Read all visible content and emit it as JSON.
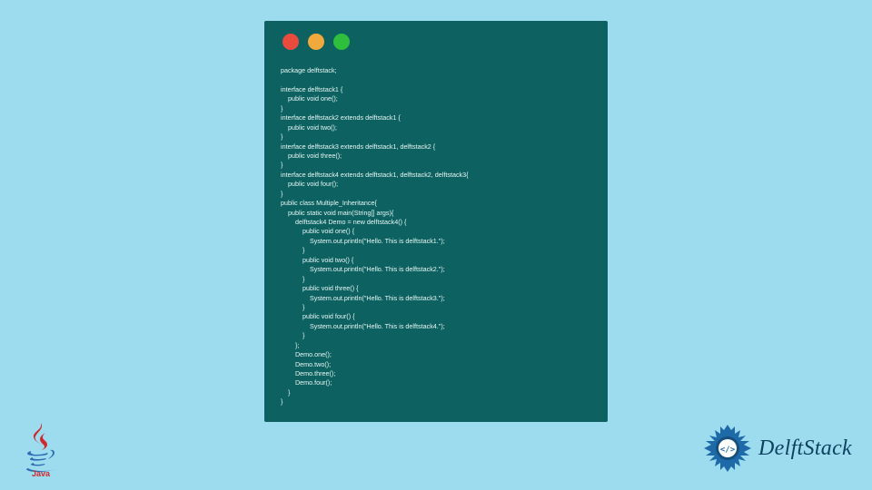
{
  "window": {
    "controls": [
      "red",
      "yellow",
      "green"
    ]
  },
  "code": "package delftstack;\n\ninterface delftstack1 {\n    public void one();\n}\ninterface delftstack2 extends delftstack1 {\n    public void two();\n}\ninterface delftstack3 extends delftstack1, delftstack2 {\n    public void three();\n}\ninterface delftstack4 extends delftstack1, delftstack2, delftstack3{\n    public void four();\n}\npublic class Multiple_Inheritance{\n    public static void main(String[] args){\n        delftstack4 Demo = new delftstack4() {\n            public void one() {\n                System.out.println(\"Hello. This is delftstack1.\");\n            }\n            public void two() {\n                System.out.println(\"Hello. This is delftstack2.\");\n            }\n            public void three() {\n                System.out.println(\"Hello. This is delftstack3.\");\n            }\n            public void four() {\n                System.out.println(\"Hello. This is delftstack4.\");\n            }\n        };\n        Demo.one();\n        Demo.two();\n        Demo.three();\n        Demo.four();\n    }\n}",
  "brand": {
    "java_label": "Java",
    "delft_label": "DelftStack"
  },
  "colors": {
    "page_bg": "#9cdcee",
    "window_bg": "#0d6261",
    "code_fg": "#e8f7f5",
    "red": "#e94b3c",
    "yellow": "#f2a93b",
    "green": "#2fbf3d",
    "delft_blue": "#1e6aa8",
    "delft_text": "#0d4160",
    "java_red": "#cf292e",
    "java_blue": "#2f6db3"
  }
}
